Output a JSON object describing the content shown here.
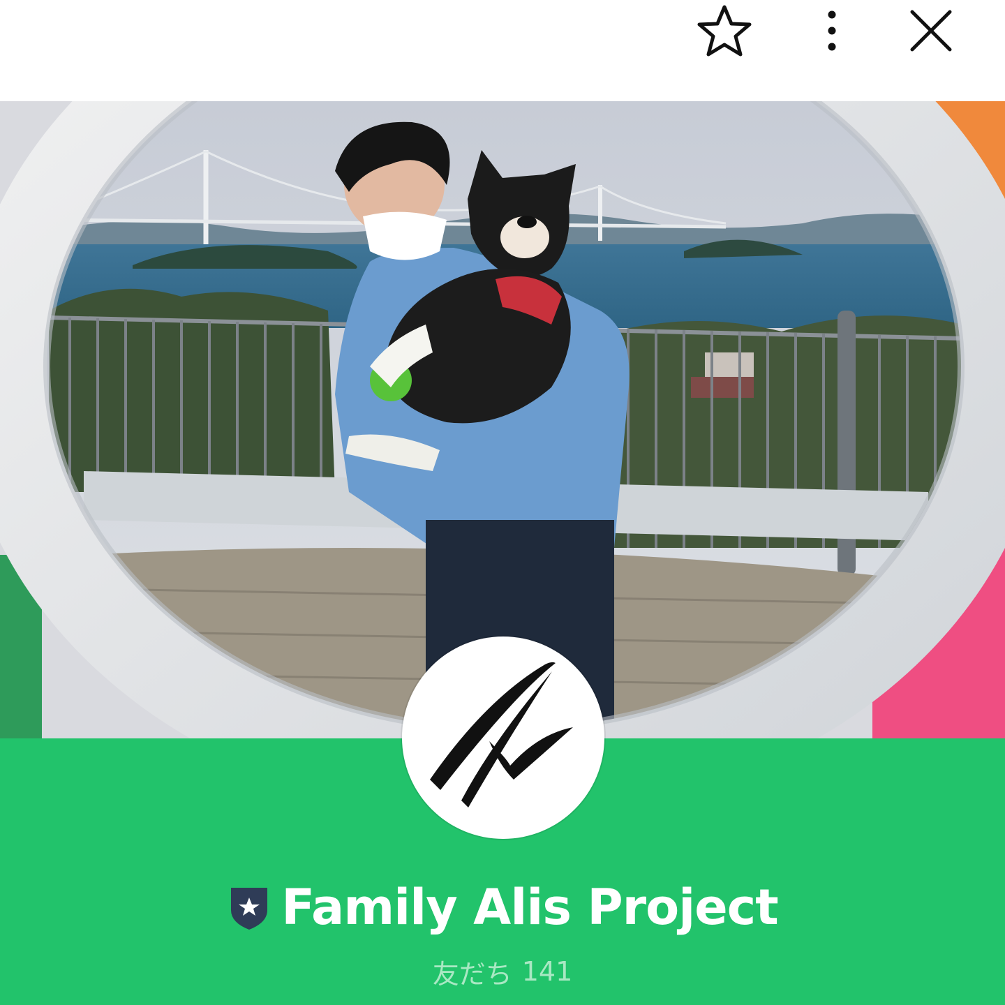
{
  "header": {
    "star_icon": "star-outline-icon",
    "more_icon": "more-vertical-icon",
    "close_icon": "close-icon"
  },
  "cover": {
    "description_icon": "cover-photo"
  },
  "avatar": {
    "icon": "brand-logo-icon"
  },
  "profile": {
    "badge_icon": "verified-shield-star-icon",
    "name": "Family Alis Project",
    "friends_label": "友だち",
    "friends_count": "141"
  },
  "colors": {
    "accent_green": "#22c36b",
    "badge_navy": "#2f3c57",
    "friends_text": "#a9e8c3"
  }
}
